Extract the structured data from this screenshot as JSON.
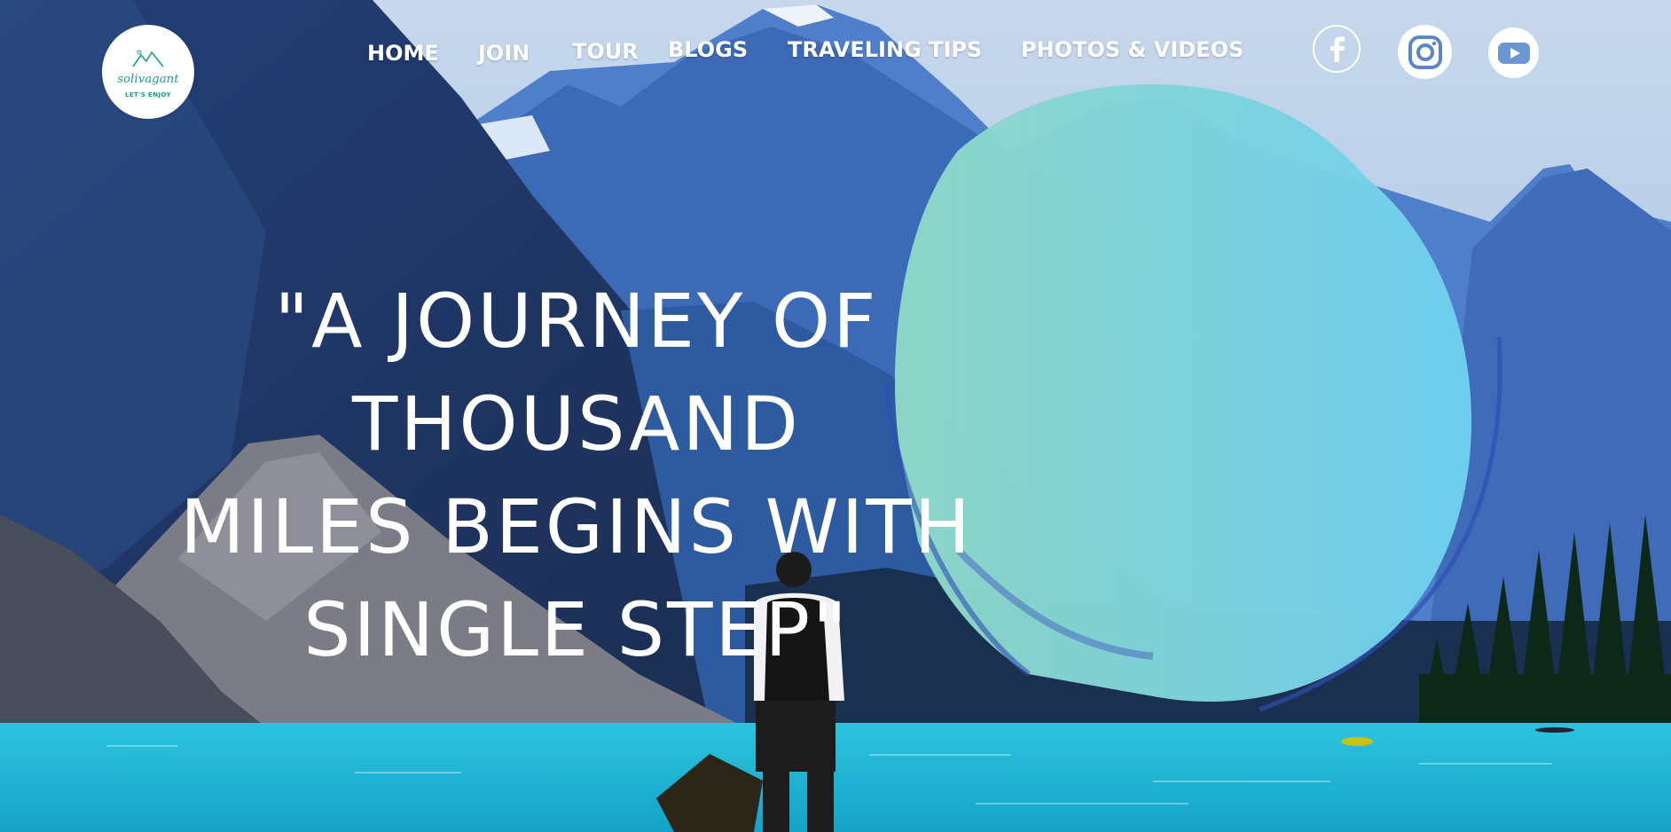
{
  "logo": {
    "name": "solivagant",
    "tagline": "LET'S ENJOY"
  },
  "nav": {
    "items": [
      {
        "id": "home",
        "label": "HOME"
      },
      {
        "id": "join",
        "label": "JOIN"
      },
      {
        "id": "tour",
        "label": "TOUR"
      },
      {
        "id": "blogs",
        "label": "BLOGS"
      },
      {
        "id": "traveling-tips",
        "label": "TRAVELING TIPS"
      },
      {
        "id": "photos-videos",
        "label": "PHOTOS & VIDEOS"
      }
    ]
  },
  "social": [
    {
      "name": "facebook-icon"
    },
    {
      "name": "instagram-icon"
    },
    {
      "name": "youtube-icon"
    }
  ],
  "hero": {
    "quote_lines": [
      "\"A JOURNEY OF THOUSAND",
      "MILES BEGINS WITH",
      "SINGLE STEP\""
    ]
  },
  "colors": {
    "brand": "#16a085",
    "circle_start": "#8fd8c7",
    "circle_end": "#6fd0f0",
    "water": "#1fb8d8"
  }
}
